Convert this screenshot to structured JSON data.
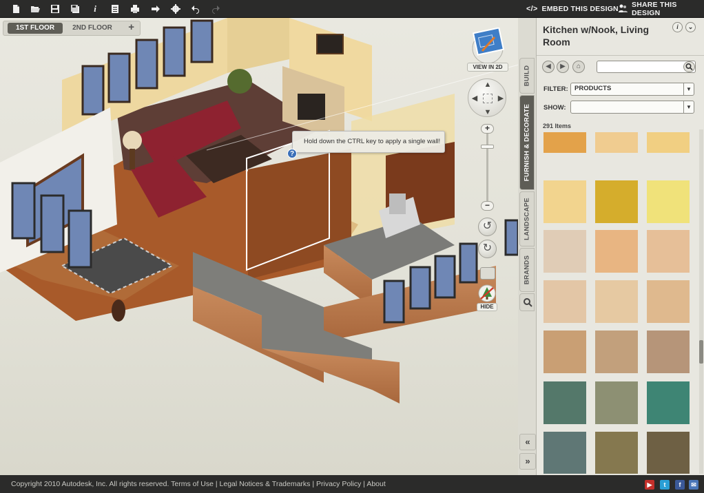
{
  "toolbar": {
    "icons": [
      "new-file-icon",
      "open-folder-icon",
      "save-icon",
      "save-as-icon",
      "info-icon",
      "list-icon",
      "print-icon",
      "export-icon",
      "settings-gear-icon",
      "undo-icon",
      "redo-icon"
    ],
    "embed_label": "EMBED THIS DESIGN",
    "embed_glyph": "</>",
    "share_label": "SHARE THIS DESIGN"
  },
  "floors": {
    "tabs": [
      {
        "label": "1ST FLOOR",
        "active": true
      },
      {
        "label": "2ND FLOOR",
        "active": false
      }
    ],
    "add_glyph": "+"
  },
  "tooltip": {
    "text": "Hold down the CTRL key to apply a single wall!",
    "help_glyph": "?"
  },
  "view_controls": {
    "view2d_label": "VIEW IN 2D",
    "zoom_in": "+",
    "zoom_out": "−",
    "zoom_level": 0.77,
    "hide_label": "HIDE"
  },
  "side_tabs": [
    {
      "label": "BUILD",
      "active": false
    },
    {
      "label": "FURNISH & DECORATE",
      "active": true
    },
    {
      "label": "LANDSCAPE",
      "active": false
    },
    {
      "label": "BRANDS",
      "active": false
    }
  ],
  "collapse": {
    "up": "«",
    "down": "»"
  },
  "panel": {
    "title": "Kitchen w/Nook, Living Room",
    "info_glyph": "i",
    "collapse_glyph": "⌄",
    "search": {
      "value": "",
      "placeholder": ""
    },
    "filter_label": "FILTER:",
    "filter_value": "PRODUCTS",
    "show_label": "SHOW:",
    "show_value": "",
    "items_count": "291 Items",
    "swatches": [
      "#e3a24a",
      "#f0cc90",
      "#f1cf82",
      "#f2d48e",
      "#d5ad2c",
      "#f0e27a",
      "#e0ccb6",
      "#e8b582",
      "#e6bf98",
      "#e3c6a6",
      "#e6c9a2",
      "#dfb98e",
      "#c99f74",
      "#c2a07c",
      "#b69579",
      "#54786a",
      "#8d9073",
      "#3e8574",
      "#5f7775",
      "#85784f",
      "#6e6044"
    ]
  },
  "footer": {
    "copyright": "Copyright 2010 Autodesk, Inc. All rights reserved.",
    "links": [
      "Terms of Use",
      "Legal Notices & Trademarks",
      "Privacy Policy",
      "About"
    ],
    "social": [
      {
        "name": "youtube-icon",
        "glyph": "▶",
        "color": "#c4302b"
      },
      {
        "name": "twitter-icon",
        "glyph": "t",
        "color": "#2a9fd6"
      },
      {
        "name": "facebook-icon",
        "glyph": "f",
        "color": "#3b5998"
      },
      {
        "name": "email-icon",
        "glyph": "✉",
        "color": "#4a76b8"
      }
    ]
  }
}
